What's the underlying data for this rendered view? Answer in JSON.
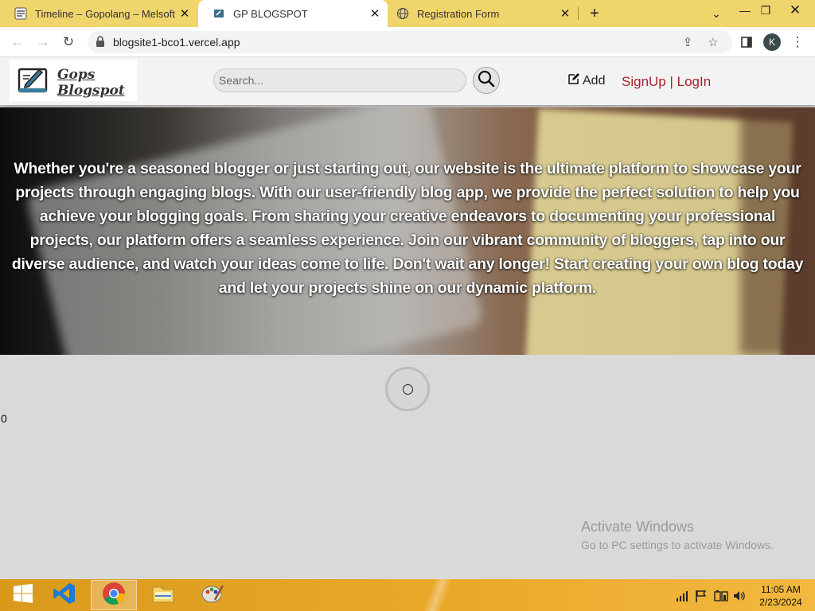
{
  "browser": {
    "tabs": [
      {
        "label": "Timeline – Gopolang – Melsoft A",
        "active": false
      },
      {
        "label": "GP BLOGSPOT",
        "active": true
      },
      {
        "label": "Registration Form",
        "active": false
      }
    ],
    "url": "blogsite1-bco1.vercel.app",
    "profile_initial": "K"
  },
  "site": {
    "logo_text": "Gops Blogspot",
    "search_placeholder": "Search...",
    "add_label": "Add",
    "auth_label": "SignUp | LogIn",
    "hero_text": "Whether you're a seasoned blogger or just starting out, our website is the ultimate platform to showcase your projects through engaging blogs. With our user-friendly blog app, we provide the perfect solution to help you achieve your blogging goals. From sharing your creative endeavors to documenting your professional projects, our platform offers a seamless experience. Join our vibrant community of bloggers, tap into our diverse audience, and watch your ideas come to life. Don't wait any longer! Start creating your own blog today and let your projects shine on our dynamic platform.",
    "post_count": "0"
  },
  "watermark": {
    "line1": "Activate Windows",
    "line2": "Go to PC settings to activate Windows."
  },
  "taskbar": {
    "apps": [
      "windows-start",
      "vscode",
      "chrome",
      "file-explorer",
      "paint"
    ],
    "time": "11:05 AM",
    "date": "2/23/2024"
  },
  "colors": {
    "tabstrip": "#f0d46c",
    "auth_link": "#a8222a",
    "taskbar": "#e5a526"
  }
}
